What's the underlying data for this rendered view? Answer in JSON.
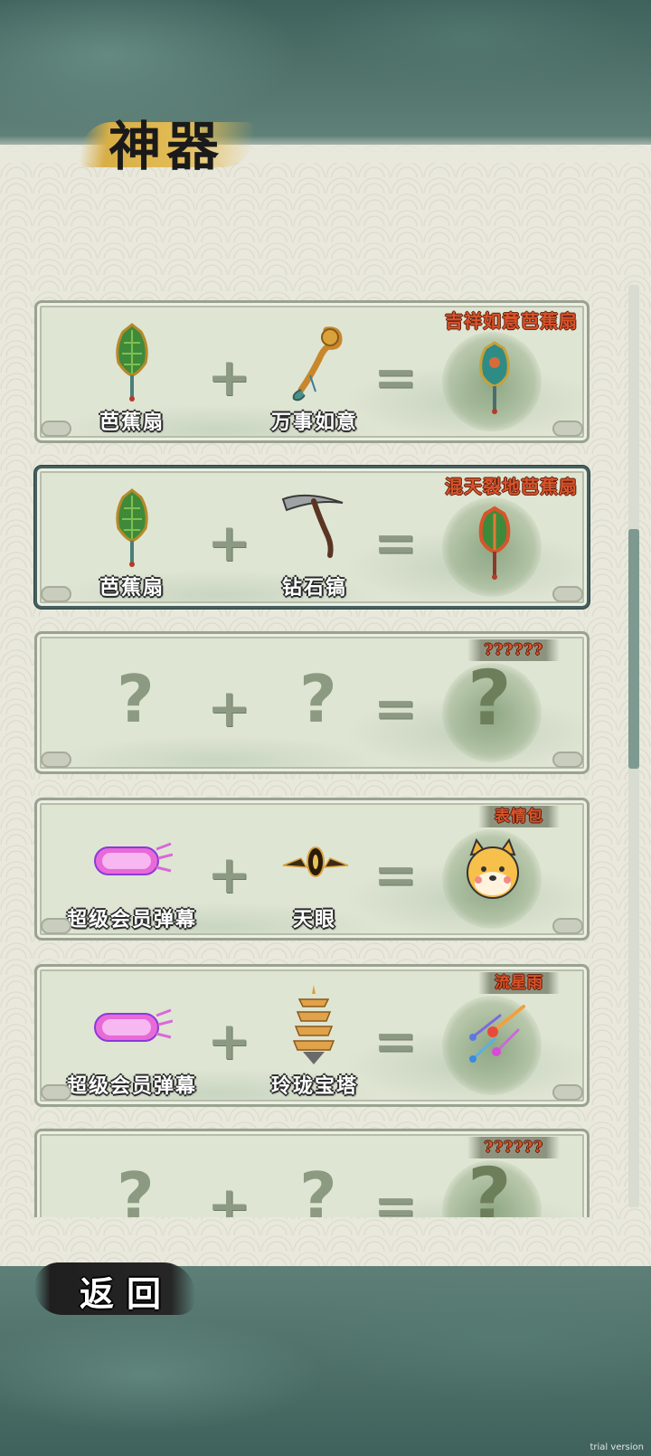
{
  "title": "神器",
  "recipes": [
    {
      "item1": "芭蕉扇",
      "item2": "万事如意",
      "result": "吉祥如意芭蕉扇",
      "plus": "+",
      "equals": "=",
      "known": true
    },
    {
      "item1": "芭蕉扇",
      "item2": "钻石镐",
      "result": "混天裂地芭蕉扇",
      "plus": "+",
      "equals": "=",
      "known": true
    },
    {
      "item1": "?",
      "item2": "?",
      "result": "??????",
      "result_icon": "?",
      "plus": "+",
      "equals": "=",
      "known": false
    },
    {
      "item1": "超级会员弹幕",
      "item2": "天眼",
      "result": "表情包",
      "plus": "+",
      "equals": "=",
      "known": true
    },
    {
      "item1": "超级会员弹幕",
      "item2": "玲珑宝塔",
      "result": "流星雨",
      "plus": "+",
      "equals": "=",
      "known": true
    },
    {
      "item1": "?",
      "item2": "?",
      "result": "??????",
      "result_icon": "?",
      "plus": "+",
      "equals": "=",
      "known": false
    }
  ],
  "return_label": "返回",
  "watermark": "trial version",
  "icons": {
    "fan": "palm-leaf-fan-icon",
    "ruyi": "ruyi-scepter-icon",
    "pickaxe": "diamond-pickaxe-icon",
    "danmaku": "super-vip-danmaku-icon",
    "eye": "heavenly-eye-icon",
    "pagoda": "exquisite-pagoda-icon",
    "emoji": "shiba-emoji-icon",
    "meteor": "meteor-shower-icon"
  },
  "colors": {
    "result_label": "#d9542a",
    "card_bg": "#dfe5d3",
    "scroll_thumb": "#7e9a90"
  }
}
